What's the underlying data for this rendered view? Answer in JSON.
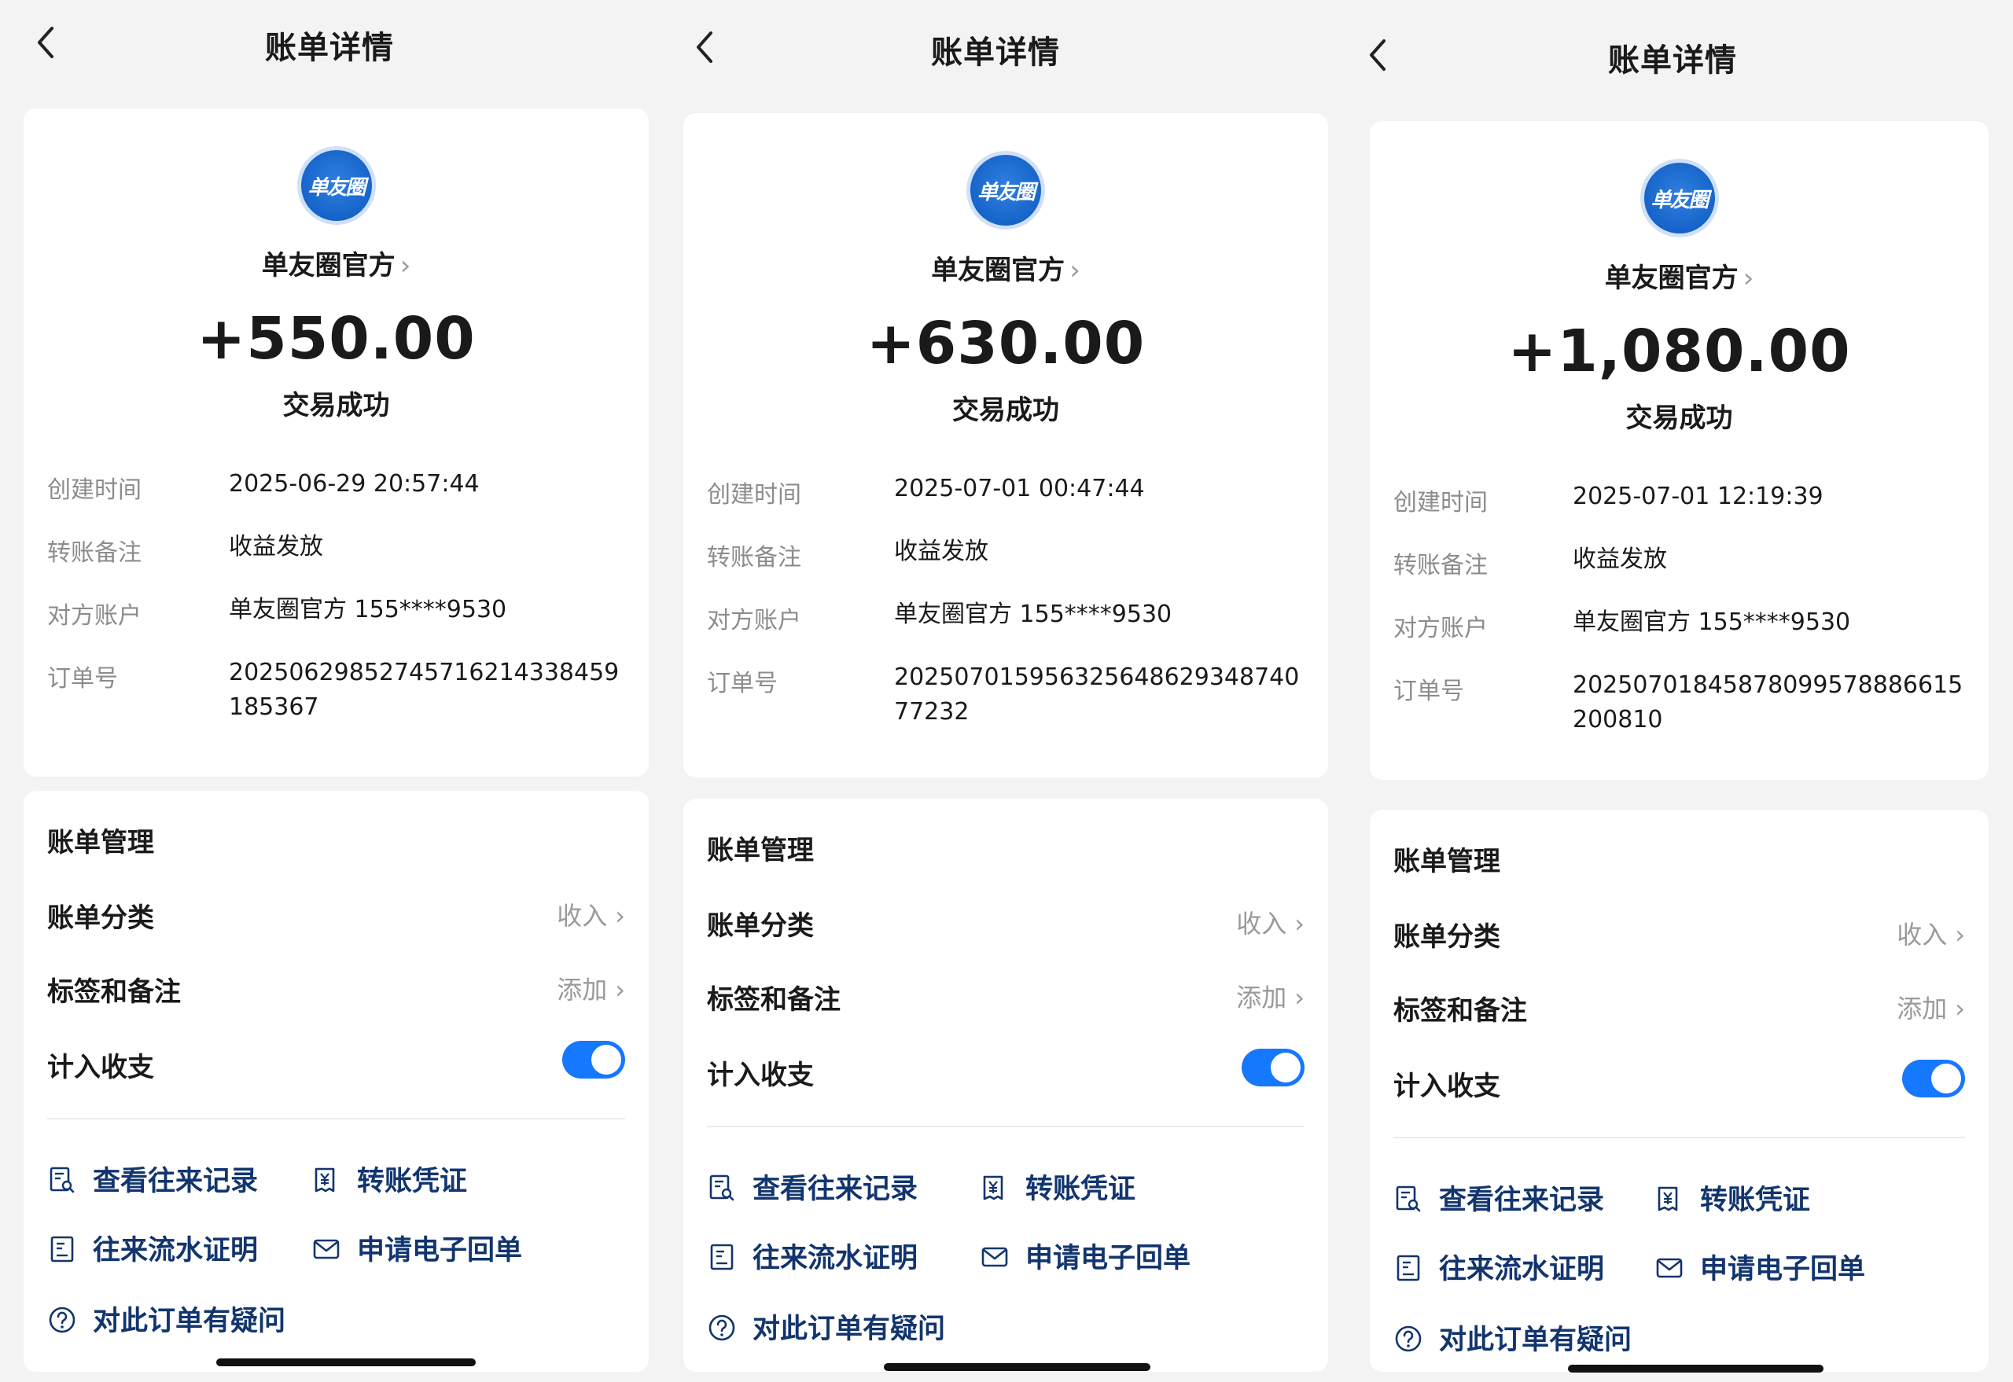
{
  "screens": [
    {
      "header": {
        "title": "账单详情"
      },
      "merchant": {
        "logo_text": "单友圈",
        "name": "单友圈官方"
      },
      "amount": "+550.00",
      "status": "交易成功",
      "details": [
        {
          "label": "创建时间",
          "value": "2025-06-29 20:57:44"
        },
        {
          "label": "转账备注",
          "value": "收益发放"
        },
        {
          "label": "对方账户",
          "value": "单友圈官方 155****9530"
        },
        {
          "label": "订单号",
          "value": "20250629852745716214338459185367"
        }
      ],
      "management": {
        "title": "账单管理",
        "category_label": "账单分类",
        "category_value": "收入",
        "tags_label": "标签和备注",
        "tags_value": "添加",
        "include_label": "计入收支",
        "include_on": true
      },
      "links": {
        "history": "查看往来记录",
        "voucher": "转账凭证",
        "flow_proof": "往来流水证明",
        "e_receipt": "申请电子回单",
        "question": "对此订单有疑问"
      }
    },
    {
      "header": {
        "title": "账单详情"
      },
      "merchant": {
        "logo_text": "单友圈",
        "name": "单友圈官方"
      },
      "amount": "+630.00",
      "status": "交易成功",
      "details": [
        {
          "label": "创建时间",
          "value": "2025-07-01 00:47:44"
        },
        {
          "label": "转账备注",
          "value": "收益发放"
        },
        {
          "label": "对方账户",
          "value": "单友圈官方 155****9530"
        },
        {
          "label": "订单号",
          "value": "20250701595632564862934874077232"
        }
      ],
      "management": {
        "title": "账单管理",
        "category_label": "账单分类",
        "category_value": "收入",
        "tags_label": "标签和备注",
        "tags_value": "添加",
        "include_label": "计入收支",
        "include_on": true
      },
      "links": {
        "history": "查看往来记录",
        "voucher": "转账凭证",
        "flow_proof": "往来流水证明",
        "e_receipt": "申请电子回单",
        "question": "对此订单有疑问"
      }
    },
    {
      "header": {
        "title": "账单详情"
      },
      "merchant": {
        "logo_text": "单友圈",
        "name": "单友圈官方"
      },
      "amount": "+1,080.00",
      "status": "交易成功",
      "details": [
        {
          "label": "创建时间",
          "value": "2025-07-01 12:19:39"
        },
        {
          "label": "转账备注",
          "value": "收益发放"
        },
        {
          "label": "对方账户",
          "value": "单友圈官方 155****9530"
        },
        {
          "label": "订单号",
          "value": "20250701845878099578886615200810"
        }
      ],
      "management": {
        "title": "账单管理",
        "category_label": "账单分类",
        "category_value": "收入",
        "tags_label": "标签和备注",
        "tags_value": "添加",
        "include_label": "计入收支",
        "include_on": true
      },
      "links": {
        "history": "查看往来记录",
        "voucher": "转账凭证",
        "flow_proof": "往来流水证明",
        "e_receipt": "申请电子回单",
        "question": "对此订单有疑问"
      }
    }
  ],
  "colors": {
    "accent": "#1677ff",
    "link": "#12356e",
    "muted": "#8c8c8c"
  },
  "icons": {
    "back": "chevron-left-icon",
    "history": "search-record-icon",
    "voucher": "yen-voucher-icon",
    "flow_proof": "document-list-icon",
    "e_receipt": "envelope-icon",
    "question": "question-circle-icon"
  }
}
